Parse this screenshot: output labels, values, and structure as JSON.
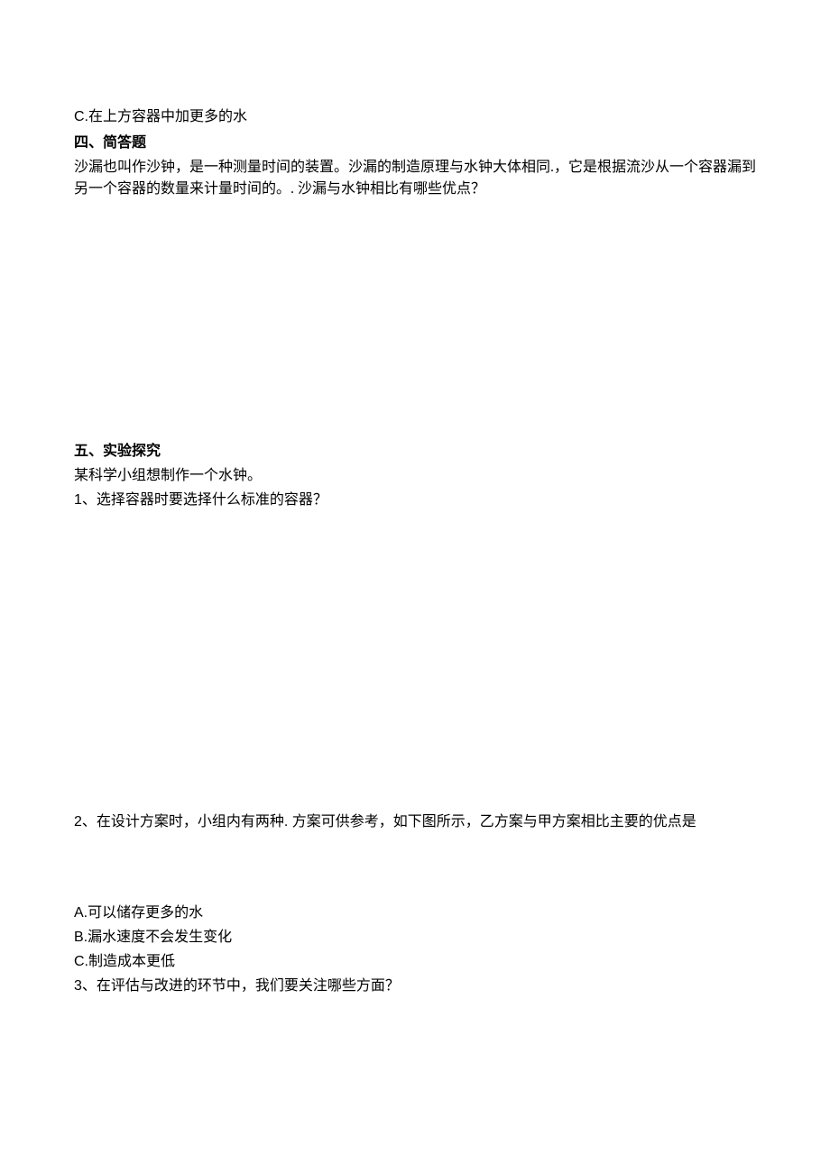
{
  "option_c_top": "C.在上方容器中加更多的水",
  "section4": {
    "heading": "四、简答题",
    "body": "沙漏也叫作沙钟，是一种测量时间的装置。沙漏的制造原理与水钟大体相同.，它是根据流沙从一个容器漏到另一个容器的数量来计量时间的。. 沙漏与水钟相比有哪些优点？"
  },
  "section5": {
    "heading": "五、实验探究",
    "intro": "某科学小组想制作一个水钟。",
    "q1": "1、选择容器时要选择什么标准的容器？",
    "q2": "2、在设计方案时，小组内有两种. 方案可供参考，如下图所示，乙方案与甲方案相比主要的优点是",
    "options": {
      "a": "A.可以储存更多的水",
      "b": "B.漏水速度不会发生变化",
      "c": "C.制造成本更低"
    },
    "q3": "3、在评估与改进的环节中，我们要关注哪些方面？"
  }
}
